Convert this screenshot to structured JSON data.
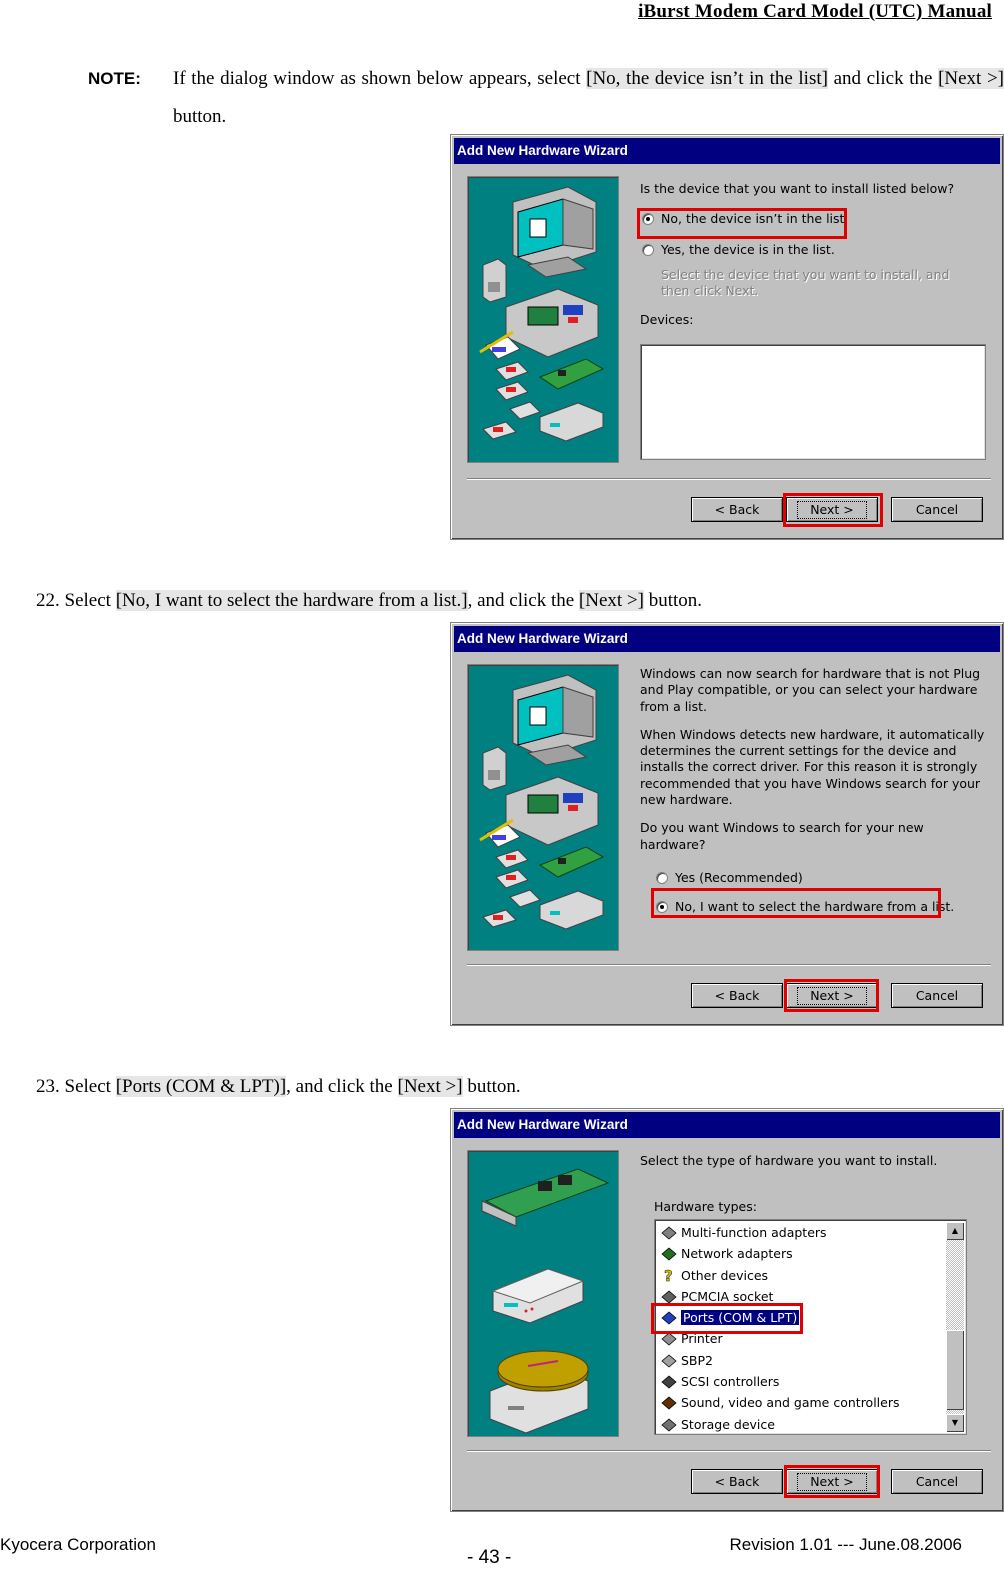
{
  "header": {
    "title": "iBurst Modem Card Model (UTC) Manual"
  },
  "note": {
    "label": "NOTE:",
    "text_pre": "If the dialog window as shown below appears, select ",
    "highlight1": "[No, the device isn’t in the list]",
    "text_mid": " and click the ",
    "highlight2": "[Next >]",
    "text_post": " button."
  },
  "steps": [
    {
      "number": "22.",
      "pre": " Select ",
      "highlight1": "[No, I want to select the hardware from a list.]",
      "mid": ", and click the ",
      "highlight2": "[Next >]",
      "post": " button."
    },
    {
      "number": "23.",
      "pre": " Select ",
      "highlight1": "[Ports (COM & LPT)]",
      "mid": ", and click the ",
      "highlight2": "[Next >]",
      "post": " button."
    }
  ],
  "dialogs": [
    {
      "title": "Add New Hardware Wizard",
      "question": "Is the device that you want to install listed below?",
      "options": [
        {
          "label": "No, the device isn’t in the list.",
          "accel": "N",
          "selected": true
        },
        {
          "label": "Yes, the device is in the list.",
          "accel": "Y",
          "selected": false
        }
      ],
      "hint": "Select the device that you want to install, and then click Next.",
      "devices_label": "Devices:",
      "buttons": {
        "back": "< Back",
        "next": "Next >",
        "cancel": "Cancel"
      }
    },
    {
      "title": "Add New Hardware Wizard",
      "paragraphs": [
        "Windows can now search for hardware that is not Plug and Play compatible, or you can select your hardware from a list.",
        "When Windows detects new hardware, it automatically determines the current settings for the device and installs the correct driver. For this reason it is strongly recommended that you have Windows search for your new hardware.",
        "Do you want Windows to search for your new hardware?"
      ],
      "options": [
        {
          "label": "Yes (Recommended)",
          "accel": "Y",
          "selected": false
        },
        {
          "label": "No, I want to select the hardware from a list.",
          "accel": "N",
          "selected": true
        }
      ],
      "buttons": {
        "back": "< Back",
        "next": "Next >",
        "cancel": "Cancel"
      }
    },
    {
      "title": "Add New Hardware Wizard",
      "instruction": "Select the type of hardware you want to install.",
      "list_label": "Hardware types:",
      "hardware_types": [
        {
          "label": "Multi-function adapters",
          "icon": "multifunction-icon",
          "selected": false
        },
        {
          "label": "Network adapters",
          "icon": "network-adapter-icon",
          "selected": false
        },
        {
          "label": "Other devices",
          "icon": "question-mark-icon",
          "selected": false
        },
        {
          "label": "PCMCIA socket",
          "icon": "pcmcia-icon",
          "selected": false
        },
        {
          "label": "Ports (COM & LPT)",
          "icon": "port-connector-icon",
          "selected": true
        },
        {
          "label": "Printer",
          "icon": "printer-icon",
          "selected": false
        },
        {
          "label": "SBP2",
          "icon": "sbp2-icon",
          "selected": false
        },
        {
          "label": "SCSI controllers",
          "icon": "scsi-icon",
          "selected": false
        },
        {
          "label": "Sound, video and game controllers",
          "icon": "sound-icon",
          "selected": false
        },
        {
          "label": "Storage device",
          "icon": "storage-icon",
          "selected": false
        }
      ],
      "buttons": {
        "back": "< Back",
        "next": "Next >",
        "cancel": "Cancel"
      }
    }
  ],
  "footer": {
    "company": "Kyocera Corporation",
    "page": "- 43 -",
    "revision": "Revision 1.01 --- June.08.2006"
  },
  "colors": {
    "titlebar": "#000080",
    "dialog_face": "#c0c0c0",
    "art_background": "#008080",
    "highlight_box": "#e00000",
    "text_highlight": "#e6e6e6"
  }
}
